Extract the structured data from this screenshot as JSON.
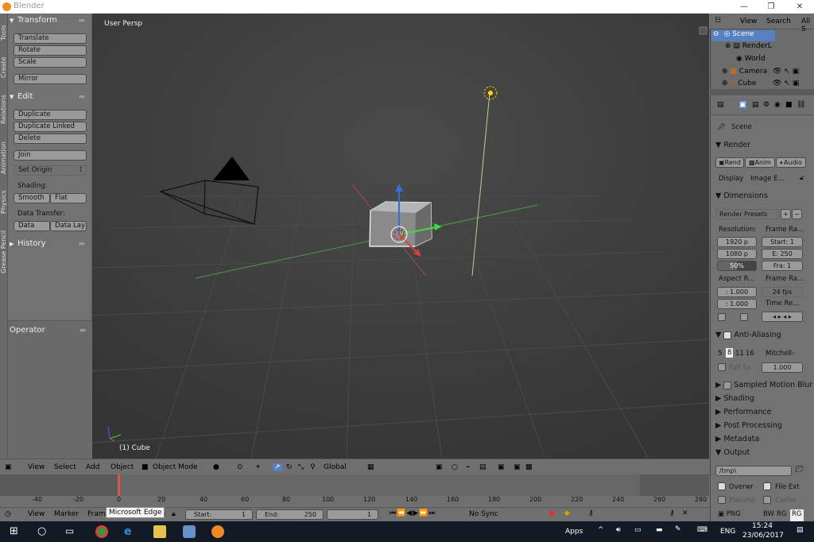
{
  "window": {
    "title": "Blender",
    "min": "—",
    "restore": "❐",
    "close": "✕"
  },
  "tabs": [
    "Tools",
    "Create",
    "Relations",
    "Animation",
    "Physics",
    "Grease Pencil"
  ],
  "toolshelf": {
    "transform": "Transform",
    "translate": "Translate",
    "rotate": "Rotate",
    "scale": "Scale",
    "mirror": "Mirror",
    "edit": "Edit",
    "duplicate": "Duplicate",
    "duplicate_linked": "Duplicate Linked",
    "delete": "Delete",
    "join": "Join",
    "set_origin": "Set Origin",
    "shading": "Shading:",
    "smooth": "Smooth",
    "flat": "Flat",
    "data_transfer": "Data Transfer:",
    "data": "Data",
    "data_lay": "Data Lay",
    "history": "History",
    "operator": "Operator"
  },
  "viewport": {
    "label": "User Persp",
    "object": "(1) Cube"
  },
  "vheader": {
    "view": "View",
    "select": "Select",
    "add": "Add",
    "object": "Object",
    "mode": "Object Mode",
    "orientation": "Global"
  },
  "timeline": {
    "ticks": [
      "-40",
      "-20",
      "0",
      "20",
      "40",
      "60",
      "80",
      "100",
      "120",
      "140",
      "160",
      "180",
      "200",
      "220",
      "240",
      "260",
      "280"
    ],
    "view": "View",
    "marker": "Marker",
    "frame": "Fram",
    "start": "Start:",
    "start_val": "1",
    "end": "End:",
    "end_val": "250",
    "current": "1",
    "sync": "No Sync"
  },
  "tooltip": "Microsoft Edge",
  "outliner": {
    "view": "View",
    "search": "Search",
    "all": "All S",
    "items": [
      "Scene",
      "RenderL",
      "World",
      "Camera",
      "Cube"
    ]
  },
  "properties": {
    "context": "Scene",
    "render": "Render",
    "rend": "Rend",
    "anim": "Anim",
    "audio": "Audio",
    "display": "Display",
    "display_val": "Image E...",
    "dimensions": "Dimensions",
    "presets": "Render Presets",
    "resolution": "Resolution:",
    "frame_range": "Frame Ra...",
    "res_x": "1920 p",
    "res_y": "1080 p",
    "res_pct": "50%",
    "start": "Start: 1",
    "end": "E: 250",
    "fra": "Fra: 1",
    "aspect": "Aspect R...",
    "frame_rate": "Frame Ra...",
    "asp_x": ": 1.000",
    "asp_y": ": 1.000",
    "fps": "24 fps",
    "time_re": "Time Re...",
    "aa": "Anti-Aliasing",
    "aa_5": "5",
    "aa_8": "8",
    "aa_11": "11",
    "aa_16": "16",
    "aa_filter": "Mitchell-",
    "full_sa": "Full Sa",
    "aa_val": "1.000",
    "motion_blur": "Sampled Motion Blur",
    "shading": "Shading",
    "performance": "Performance",
    "post": "Post Processing",
    "metadata": "Metadata",
    "output": "Output",
    "path": "/tmp\\",
    "overwr": "Overwr",
    "file_ext": "File Ext",
    "placeho": "Placeho",
    "cache": "Cache",
    "png": "PNG",
    "bw": "BW",
    "rg": "RG",
    "rgb": "RG"
  },
  "taskbar": {
    "apps": "Apps",
    "lang": "ENG",
    "time": "15:24",
    "date": "23/06/2017"
  },
  "colors": {
    "accent": "#5680c2",
    "viewport": "#393939",
    "panel": "#727272",
    "taskbar": "#121a26"
  }
}
